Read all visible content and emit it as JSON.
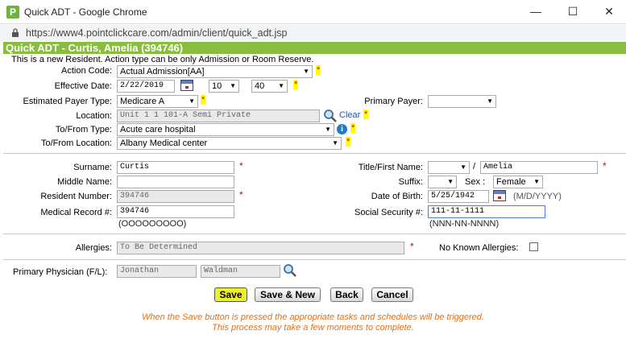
{
  "window": {
    "title": "Quick ADT - Google Chrome",
    "url": "https://www4.pointclickcare.com/admin/client/quick_adt.jsp",
    "app_icon_letter": "P"
  },
  "header": {
    "title": "Quick ADT - Curtis, Amelia (394746)",
    "notice": "This is a new Resident. Action type can be only Admission or Room Reserve."
  },
  "form": {
    "action_code": {
      "label": "Action Code:",
      "value": "Actual Admission[AA]"
    },
    "effective_date": {
      "label": "Effective Date:",
      "date": "2/22/2019",
      "hour": "10",
      "minute": "40"
    },
    "payer_type": {
      "label": "Estimated Payer Type:",
      "value": "Medicare A"
    },
    "primary_payer": {
      "label": "Primary Payer:",
      "value": ""
    },
    "location": {
      "label": "Location:",
      "value": "Unit 1 1 101-A Semi Private",
      "clear": "Clear"
    },
    "to_from_type": {
      "label": "To/From Type:",
      "value": "Acute care hospital"
    },
    "to_from_location": {
      "label": "To/From Location:",
      "value": "Albany Medical center"
    },
    "surname": {
      "label": "Surname:",
      "value": "Curtis"
    },
    "middle_name": {
      "label": "Middle Name:",
      "value": ""
    },
    "resident_number": {
      "label": "Resident Number:",
      "value": "394746"
    },
    "medical_record": {
      "label": "Medical Record #:",
      "value": "394746",
      "hint": "(OOOOOOOOO)"
    },
    "title_first": {
      "label": "Title/First Name:",
      "title": "",
      "slash": "/",
      "first": "Amelia"
    },
    "suffix": {
      "label": "Suffix:",
      "value": ""
    },
    "sex": {
      "label": "Sex :",
      "value": "Female"
    },
    "dob": {
      "label": "Date of Birth:",
      "value": "5/25/1942",
      "hint": "(M/D/YYYY)"
    },
    "ssn": {
      "label": "Social Security #:",
      "value": "111-11-1111",
      "hint": "(NNN-NN-NNNN)"
    },
    "allergies": {
      "label": "Allergies:",
      "value": "To Be Determined",
      "nka_label": "No Known Allergies:"
    },
    "physician": {
      "label": "Primary Physician (F/L):",
      "first": "Jonathan",
      "last": "Waldman"
    },
    "required_mark": "*"
  },
  "buttons": {
    "save": "Save",
    "save_new": "Save & New",
    "back": "Back",
    "cancel": "Cancel"
  },
  "footer": {
    "line1": "When the Save button is pressed the appropriate tasks and schedules will be triggered.",
    "line2": "This process may take a few moments to complete."
  },
  "colors": {
    "header_bg": "#88bd3f",
    "save_button": "#ecef2e",
    "required": "#dd0000",
    "footnote": "#e07018"
  }
}
